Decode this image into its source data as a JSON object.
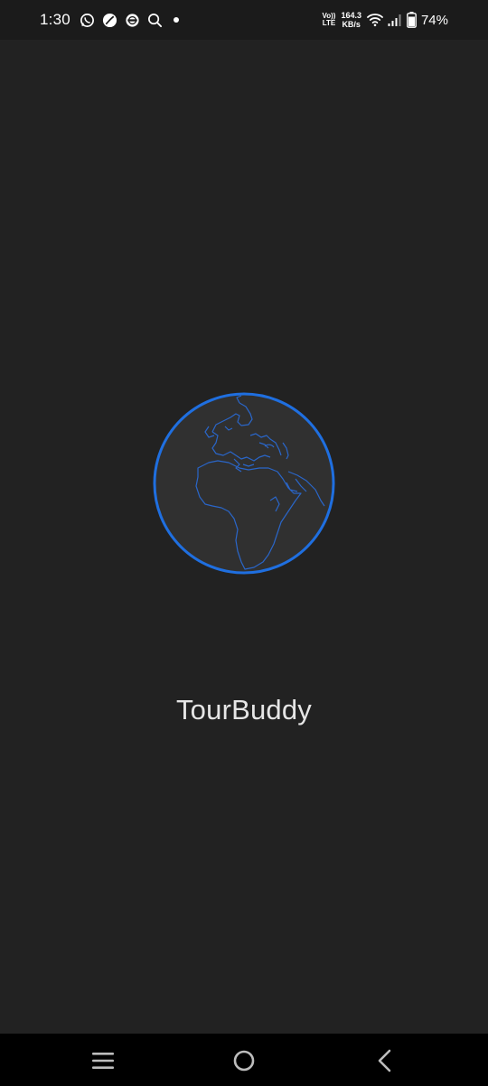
{
  "status_bar": {
    "time": "1:30",
    "volte_top": "Vo))",
    "volte_bottom": "LTE",
    "speed_value": "164.3",
    "speed_unit": "KB/s",
    "battery_pct": "74%",
    "icons": [
      "whatsapp-icon",
      "app-leaf-icon",
      "vpn-icon",
      "search-icon",
      "notification-dot-icon",
      "wifi-icon",
      "signal-icon",
      "battery-icon"
    ]
  },
  "splash": {
    "app_name": "TourBuddy",
    "logo": "globe-icon",
    "accent_color": "#1f6fe0"
  },
  "nav_bar": {
    "icons": [
      "recents-icon",
      "home-icon",
      "back-icon"
    ]
  }
}
